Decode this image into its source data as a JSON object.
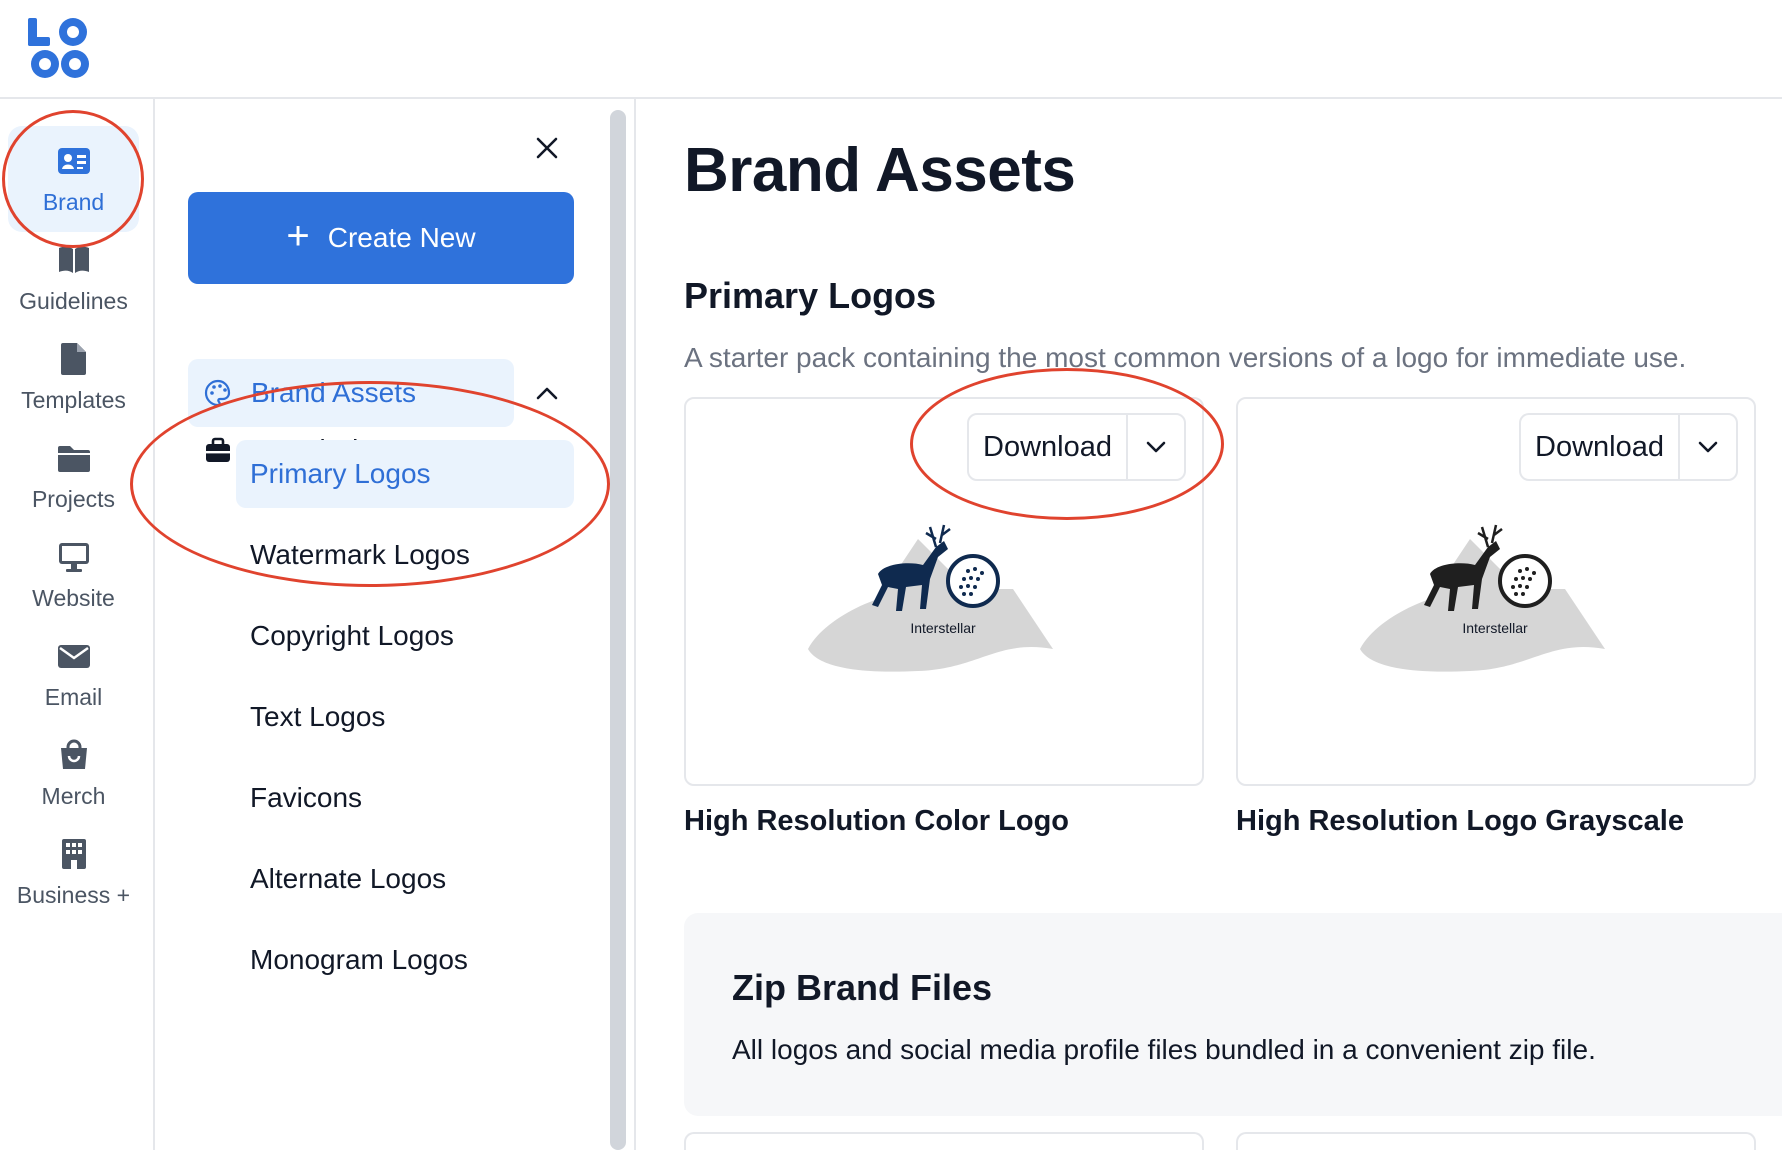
{
  "header": {
    "logo_text": "LOGO"
  },
  "rail": {
    "items": [
      {
        "label": "Brand",
        "icon": "id-card-icon",
        "active": true
      },
      {
        "label": "Guidelines",
        "icon": "book-icon"
      },
      {
        "label": "Templates",
        "icon": "file-icon"
      },
      {
        "label": "Projects",
        "icon": "folder-icon"
      },
      {
        "label": "Website",
        "icon": "monitor-icon"
      },
      {
        "label": "Email",
        "icon": "envelope-icon"
      },
      {
        "label": "Merch",
        "icon": "shopping-bag-icon"
      },
      {
        "label": "Business +",
        "icon": "building-icon"
      }
    ]
  },
  "subnav": {
    "create_label": "Create New",
    "brand_kit": "Brand Kit",
    "brand_assets": "Brand Assets",
    "items": [
      {
        "label": "Primary Logos",
        "active": true
      },
      {
        "label": "Watermark Logos"
      },
      {
        "label": "Copyright Logos"
      },
      {
        "label": "Text Logos"
      },
      {
        "label": "Favicons"
      },
      {
        "label": "Alternate Logos"
      },
      {
        "label": "Monogram Logos"
      }
    ]
  },
  "main": {
    "title": "Brand Assets",
    "section_title": "Primary Logos",
    "section_desc": "A starter pack containing the most common versions of a logo for immediate use.",
    "cards": [
      {
        "label": "High Resolution Color Logo",
        "download": "Download",
        "logo_text": "Interstellar",
        "deer_color": "#0f2a4f"
      },
      {
        "label": "High Resolution Logo Grayscale",
        "download": "Download",
        "logo_text": "Interstellar",
        "deer_color": "#1f1f1f"
      }
    ],
    "zip": {
      "title": "Zip Brand Files",
      "desc": "All logos and social media profile files bundled in a convenient zip file."
    }
  },
  "colors": {
    "accent": "#2f72db",
    "active_bg": "#eaf3fd",
    "annotation": "#e0432e"
  }
}
